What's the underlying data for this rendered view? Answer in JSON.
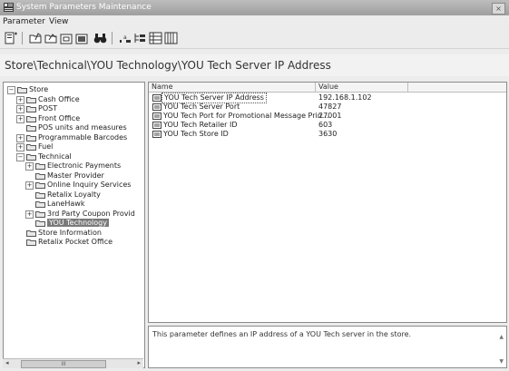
{
  "window": {
    "title": "System Parameters Maintenance",
    "close_label": "×"
  },
  "menu": {
    "items": [
      "Parameter",
      "View"
    ]
  },
  "toolbar": {
    "buttons": [
      "new-parameter-icon",
      "open-icon",
      "forward-icon",
      "copy-icon",
      "paste-icon",
      "find-icon",
      "sort-icon",
      "tree-view-icon",
      "list-view-icon",
      "details-view-icon"
    ]
  },
  "breadcrumb": {
    "path": "Store\\Technical\\YOU Technology\\YOU Tech Server IP Address"
  },
  "tree": {
    "items": [
      {
        "label": "Store",
        "level": 0,
        "expander": "−"
      },
      {
        "label": "Cash Office",
        "level": 1,
        "expander": "+"
      },
      {
        "label": "POST",
        "level": 1,
        "expander": "+"
      },
      {
        "label": "Front Office",
        "level": 1,
        "expander": "+"
      },
      {
        "label": "POS units and measures",
        "level": 1,
        "expander": ""
      },
      {
        "label": "Programmable Barcodes",
        "level": 1,
        "expander": "+"
      },
      {
        "label": "Fuel",
        "level": 1,
        "expander": "+"
      },
      {
        "label": "Technical",
        "level": 1,
        "expander": "−"
      },
      {
        "label": "Electronic Payments",
        "level": 2,
        "expander": "+"
      },
      {
        "label": "Master Provider",
        "level": 2,
        "expander": ""
      },
      {
        "label": "Online Inquiry Services",
        "level": 2,
        "expander": "+"
      },
      {
        "label": "Retalix Loyalty",
        "level": 2,
        "expander": ""
      },
      {
        "label": "LaneHawk",
        "level": 2,
        "expander": ""
      },
      {
        "label": "3rd Party Coupon Provid",
        "level": 2,
        "expander": "+"
      },
      {
        "label": "YOU Technology",
        "level": 2,
        "expander": "",
        "selected": true
      },
      {
        "label": "Store Information",
        "level": 1,
        "expander": ""
      },
      {
        "label": "Retalix Pocket Office",
        "level": 1,
        "expander": ""
      }
    ]
  },
  "list": {
    "columns": [
      "Name",
      "Value",
      ""
    ],
    "rows": [
      {
        "name": "YOU Tech Server IP Address",
        "value": "192.168.1.102"
      },
      {
        "name": "YOU Tech Server Port",
        "value": "47827"
      },
      {
        "name": "YOU Tech Port for Promotional Message Prin...",
        "value": "27001"
      },
      {
        "name": "YOU Tech Retailer ID",
        "value": "603"
      },
      {
        "name": "YOU Tech Store ID",
        "value": "3630"
      }
    ]
  },
  "description": {
    "text": "This parameter defines an IP address of a YOU Tech server in the store."
  },
  "scrollbar": {
    "thumb_label": "III"
  }
}
